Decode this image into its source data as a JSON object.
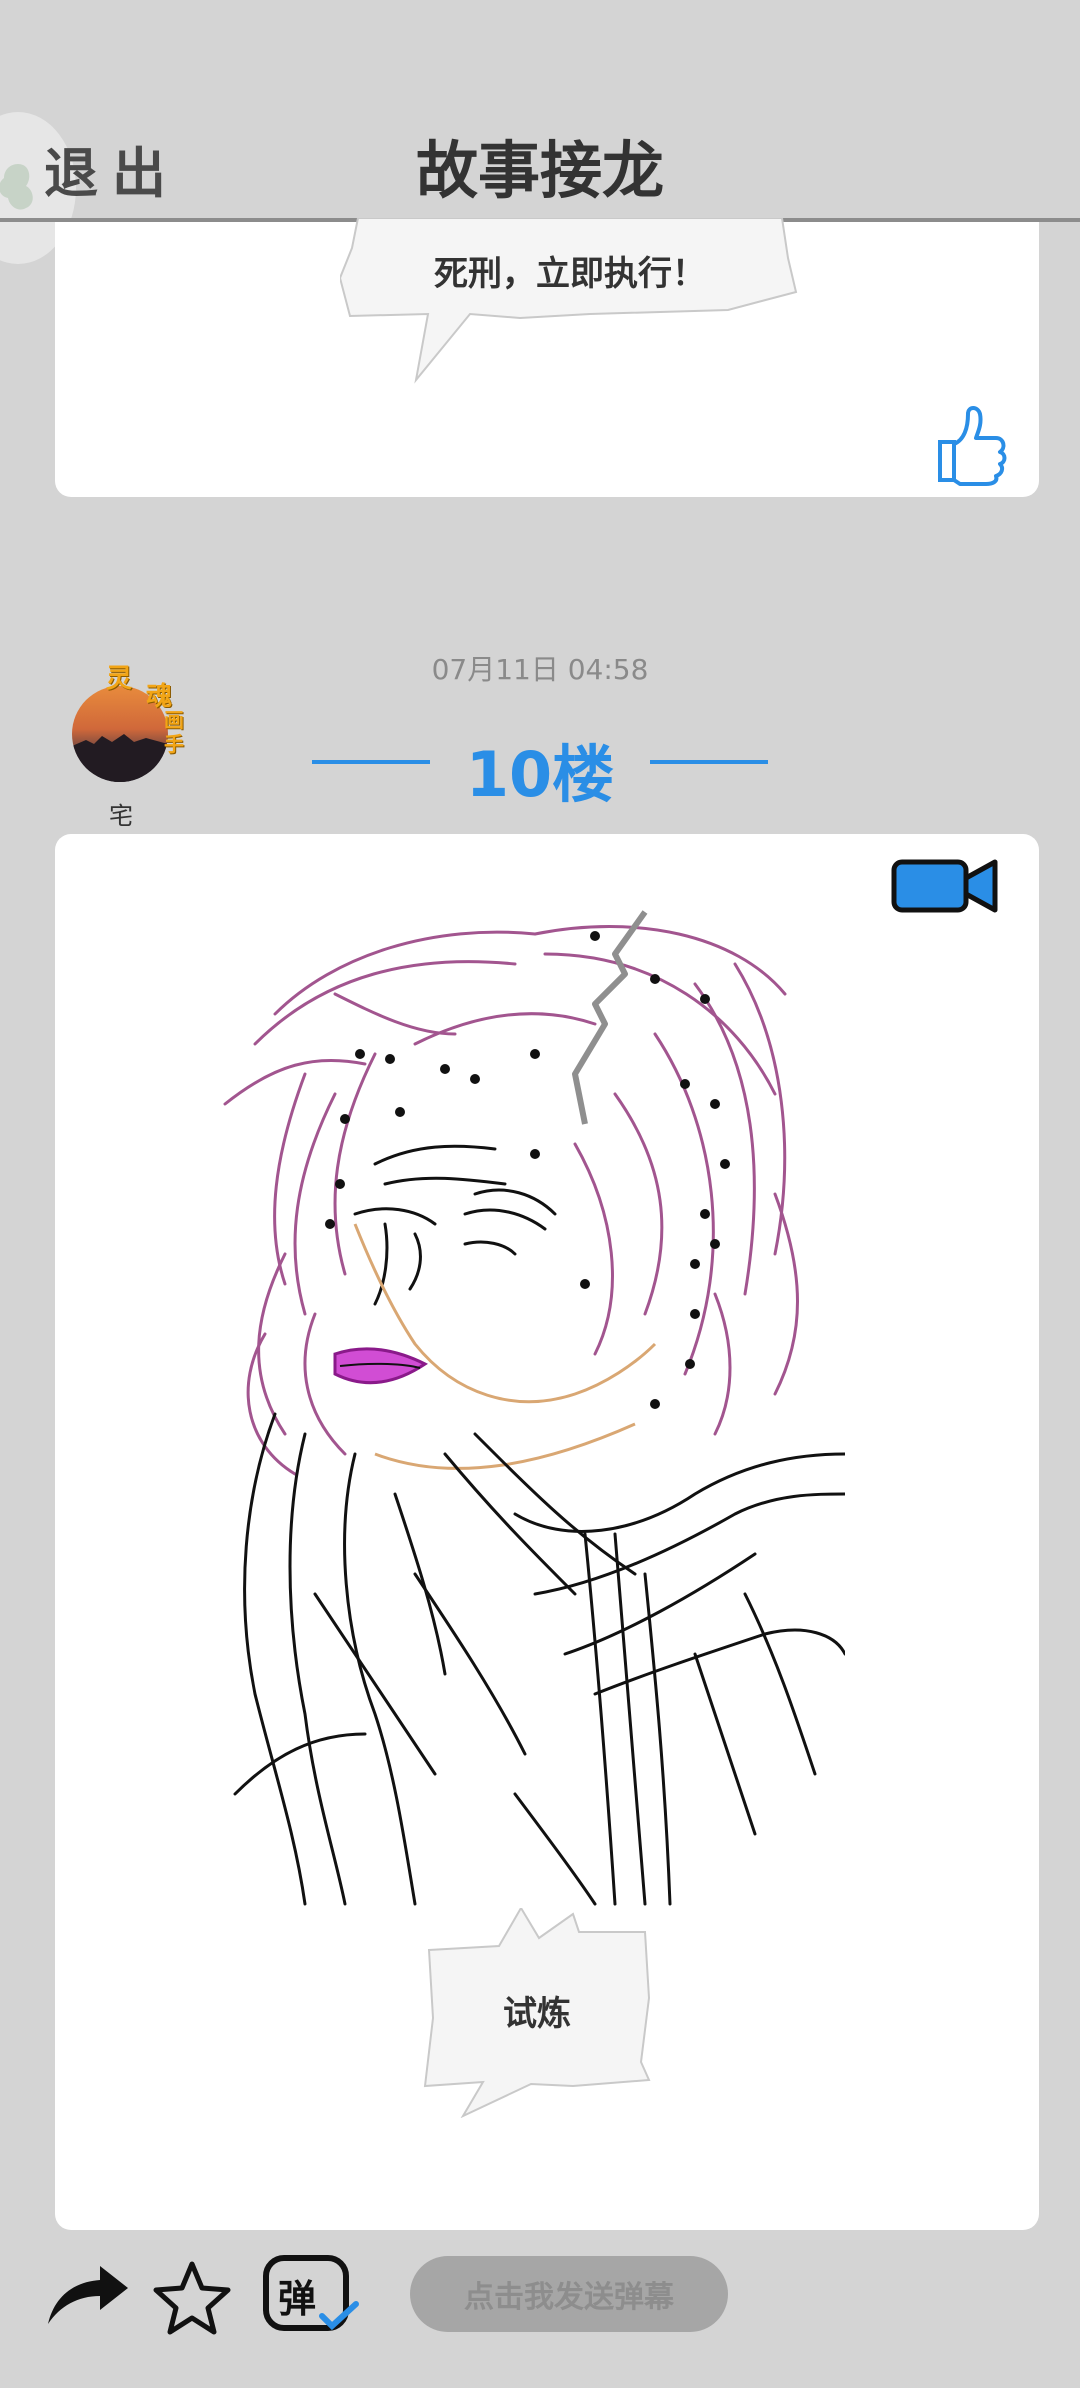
{
  "header": {
    "exit_label": "退出",
    "title": "故事接龙"
  },
  "post_prev": {
    "bubble_text": "死刑，立即执行！"
  },
  "post": {
    "timestamp": "07月11日  04:58",
    "floor_label": "10楼",
    "author": {
      "name": "宅",
      "badge_chars": [
        "灵",
        "魂",
        "画",
        "手"
      ]
    },
    "bubble_text": "试炼"
  },
  "toolbar": {
    "danmaku_placeholder": "点击我发送弹幕",
    "danmaku_icon_char": "弹"
  },
  "icons": {
    "back": "back-bubble-icon",
    "like": "thumbs-up-icon",
    "video": "video-camera-icon",
    "share": "share-arrow-icon",
    "favorite": "star-icon",
    "danmaku": "danmaku-icon"
  },
  "colors": {
    "accent": "#2a8ee6",
    "background": "#d4d4d4",
    "card": "#ffffff"
  }
}
